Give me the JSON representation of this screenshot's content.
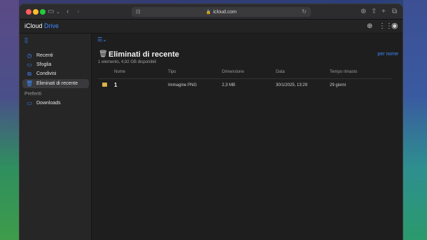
{
  "browser": {
    "url": "icloud.com"
  },
  "app": {
    "brand": "iCloud",
    "brand_product": "Drive"
  },
  "sidebar": {
    "items": [
      {
        "label": "Recenti",
        "icon": "clock-icon"
      },
      {
        "label": "Sfoglia",
        "icon": "folder-icon"
      },
      {
        "label": "Condivisi",
        "icon": "shared-folder-icon"
      },
      {
        "label": "Eliminati di recente",
        "icon": "trash-icon"
      }
    ],
    "section_label": "Preferiti",
    "favorites": [
      {
        "label": "Downloads",
        "icon": "folder-icon"
      }
    ]
  },
  "main": {
    "title": "Eliminati di recente",
    "subtitle": "1 elemento, 4,92 GB disponibili",
    "sort_label": "per nome",
    "columns": [
      "Nome",
      "Tipo",
      "Dimensione",
      "Data",
      "Tempo rimasto"
    ],
    "rows": [
      {
        "name": "1",
        "type": "Immagine PNG",
        "size": "2,3 MB",
        "date": "30/1/2025, 13:29",
        "remaining": "29 giorni"
      }
    ]
  },
  "colors": {
    "accent": "#3d8bff"
  }
}
